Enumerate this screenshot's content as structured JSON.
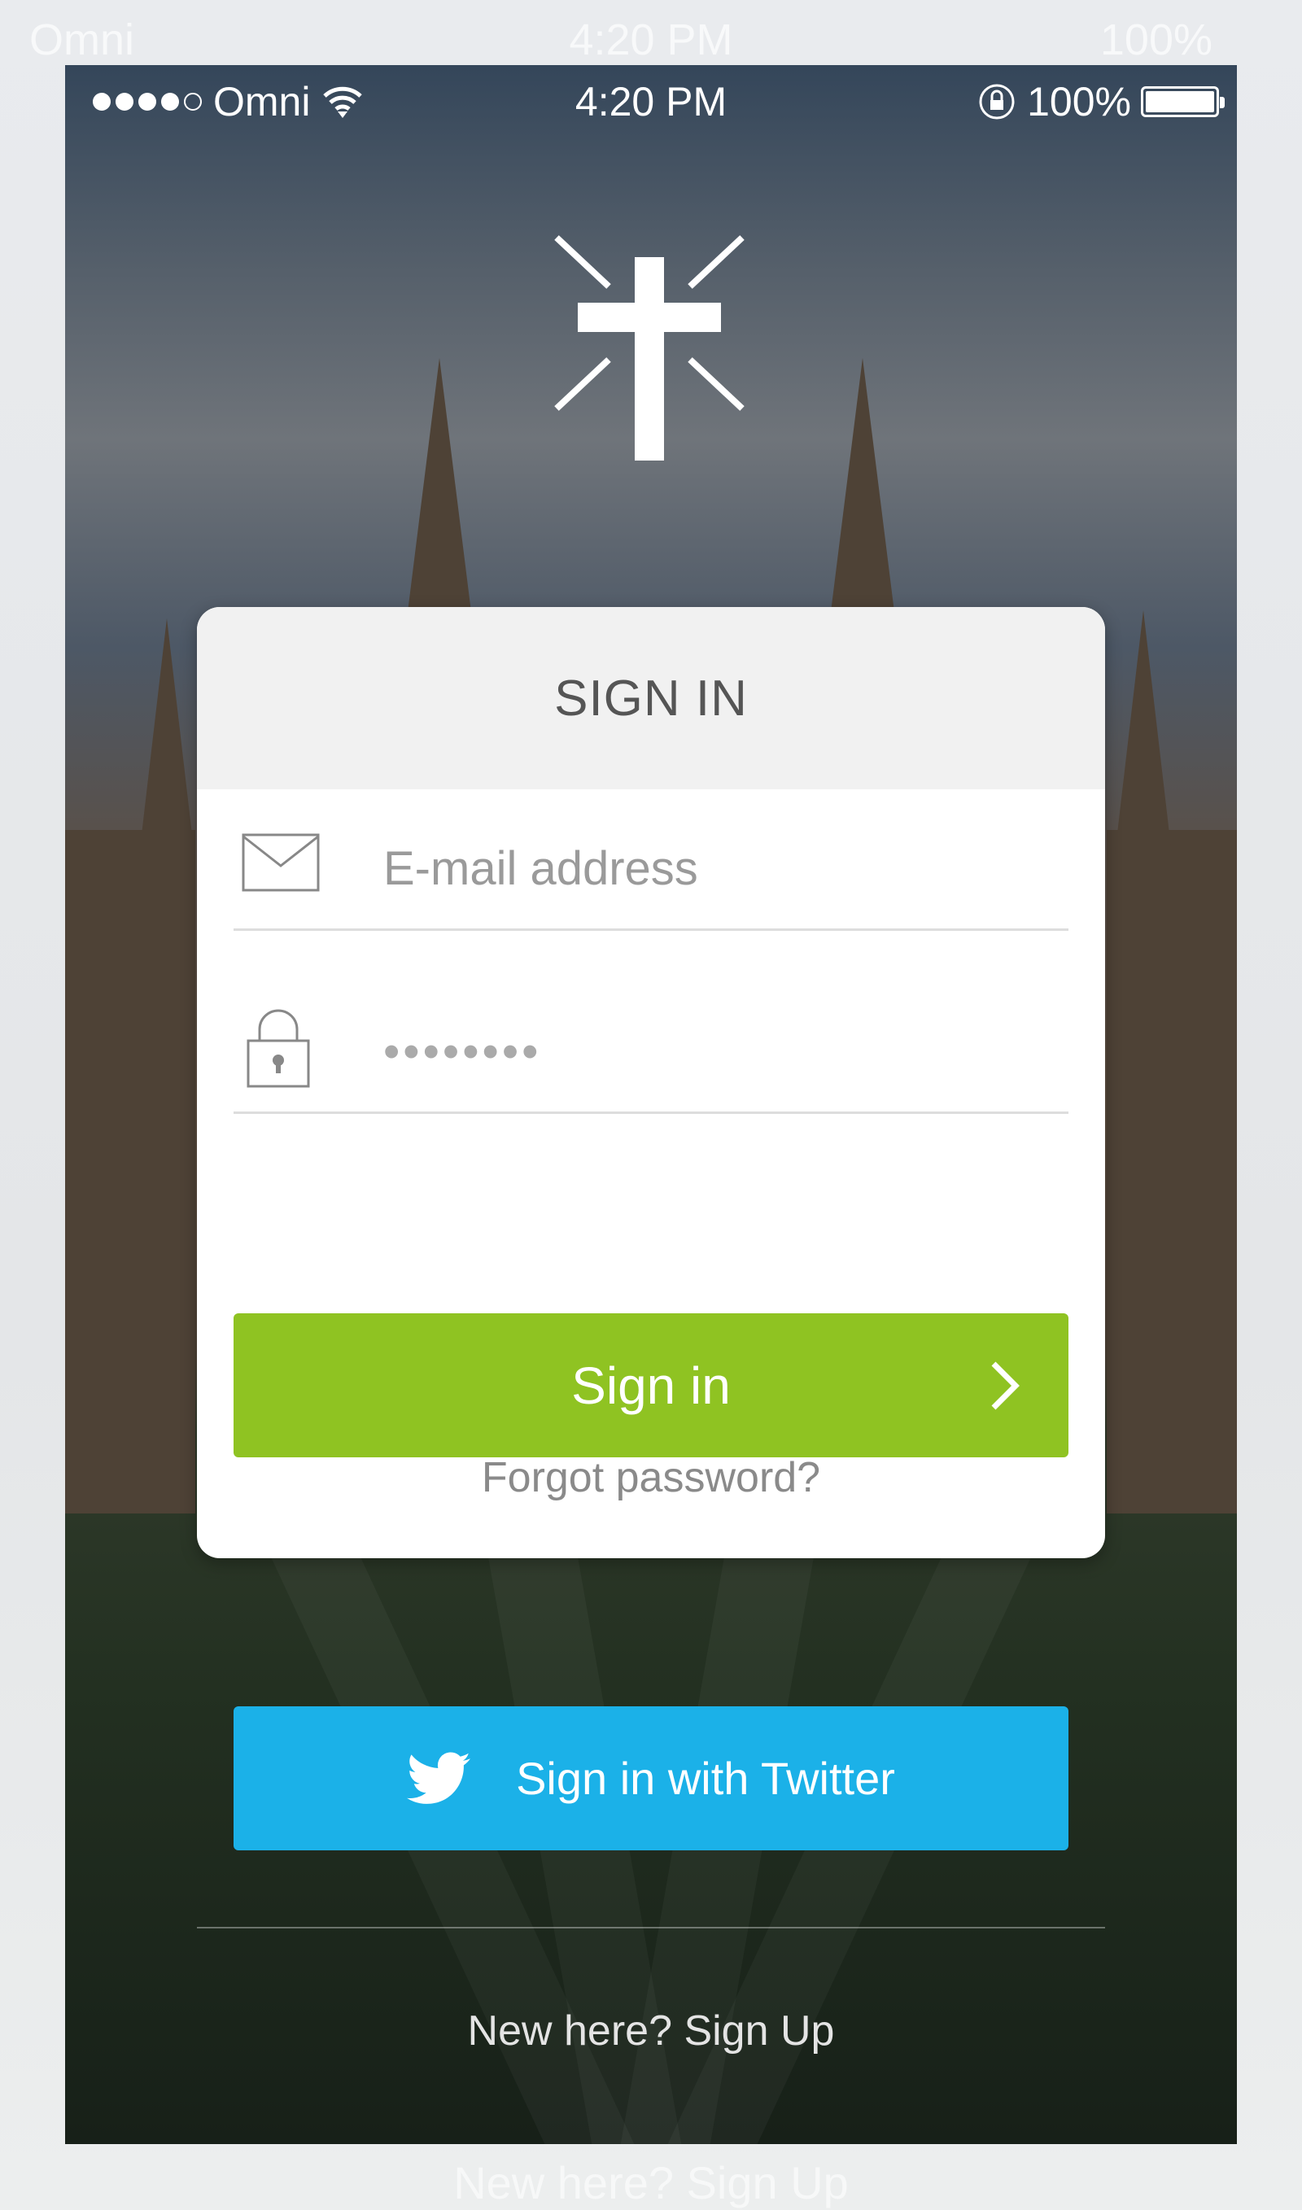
{
  "status_bar": {
    "carrier": "Omni",
    "time": "4:20 PM",
    "battery": "100%",
    "signal_bars_filled": 4,
    "signal_bars_total": 5
  },
  "card": {
    "title": "SIGN IN",
    "email_placeholder": "E-mail address",
    "password_value": "••••••••",
    "sign_in_label": "Sign in",
    "forgot_label": "Forgot password?"
  },
  "twitter": {
    "label": "Sign in with Twitter"
  },
  "footer": {
    "signup_label": "New here? Sign Up"
  },
  "colors": {
    "green": "#8fc322",
    "twitter": "#1bb1e8"
  }
}
